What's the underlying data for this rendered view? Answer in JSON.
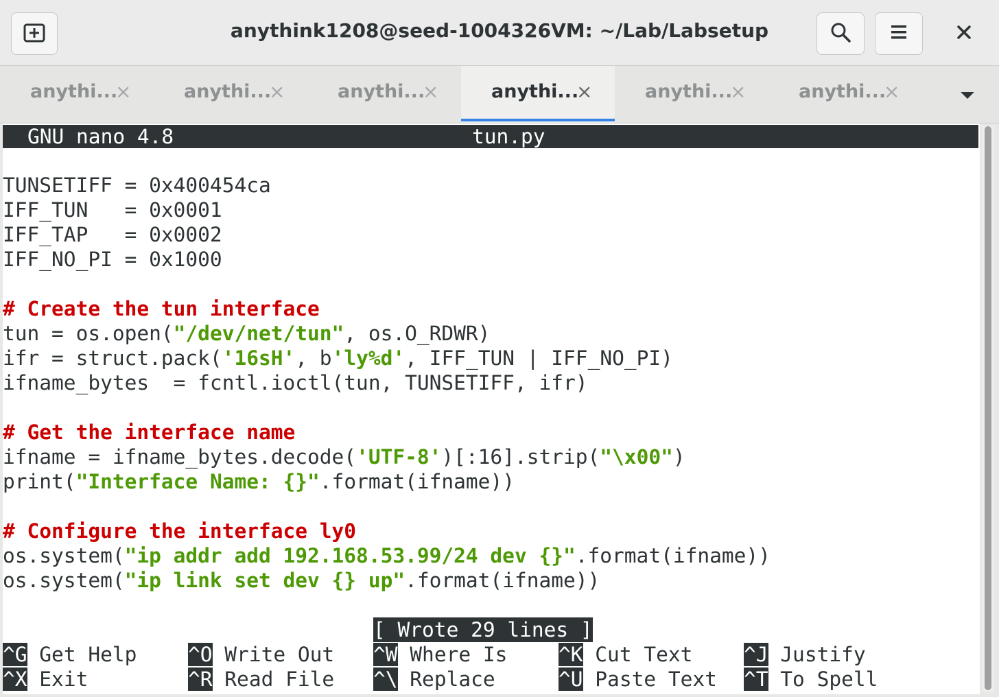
{
  "window": {
    "title": "anythink1208@seed-1004326VM: ~/Lab/Labsetup",
    "new_tab_icon": "new-tab-icon",
    "search_icon": "search-icon",
    "menu_icon": "hamburger-menu-icon",
    "close_icon": "close-icon"
  },
  "tabs": [
    {
      "label": "anythi...",
      "close": "×",
      "active": false
    },
    {
      "label": "anythi...",
      "close": "×",
      "active": false
    },
    {
      "label": "anythi...",
      "close": "×",
      "active": false
    },
    {
      "label": "anythi...",
      "close": "×",
      "active": true
    },
    {
      "label": "anythi...",
      "close": "×",
      "active": false
    },
    {
      "label": "anythi...",
      "close": "×",
      "active": false
    }
  ],
  "nano": {
    "version": "GNU nano 4.8",
    "filename": "tun.py",
    "lines": {
      "l1": "TUNSETIFF = 0x400454ca",
      "l2": "IFF_TUN   = 0x0001",
      "l3": "IFF_TAP   = 0x0002",
      "l4": "IFF_NO_PI = 0x1000",
      "c1": "# Create the tun interface",
      "l5a": "tun = os.open(",
      "l5s": "\"/dev/net/tun\"",
      "l5b": ", os.O_RDWR)",
      "l6a": "ifr = struct.pack(",
      "l6s1": "'16sH'",
      "l6b": ", b",
      "l6s2": "'ly%d'",
      "l6c": ", IFF_TUN | IFF_NO_PI)",
      "l7": "ifname_bytes  = fcntl.ioctl(tun, TUNSETIFF, ifr)",
      "c2": "# Get the interface name",
      "l8a": "ifname = ifname_bytes.decode(",
      "l8s1": "'UTF-8'",
      "l8b": ")[:16].strip(",
      "l8s2": "\"\\x00\"",
      "l8c": ")",
      "l9a": "print(",
      "l9s": "\"Interface Name: {}\"",
      "l9b": ".format(ifname))",
      "c3": "# Configure the interface ly0",
      "l10a": "os.system(",
      "l10s": "\"ip addr add 192.168.53.99/24 dev {}\"",
      "l10b": ".format(ifname))",
      "l11a": "os.system(",
      "l11s": "\"ip link set dev {} up\"",
      "l11b": ".format(ifname))"
    },
    "status": "[ Wrote 29 lines ]",
    "shortcuts": [
      {
        "key": "^G",
        "label": "Get Help"
      },
      {
        "key": "^O",
        "label": "Write Out"
      },
      {
        "key": "^W",
        "label": "Where Is"
      },
      {
        "key": "^K",
        "label": "Cut Text"
      },
      {
        "key": "^J",
        "label": "Justify"
      },
      {
        "key": "^X",
        "label": "Exit"
      },
      {
        "key": "^R",
        "label": "Read File"
      },
      {
        "key": "^\\",
        "label": "Replace"
      },
      {
        "key": "^U",
        "label": "Paste Text"
      },
      {
        "key": "^T",
        "label": "To Spell"
      }
    ]
  }
}
